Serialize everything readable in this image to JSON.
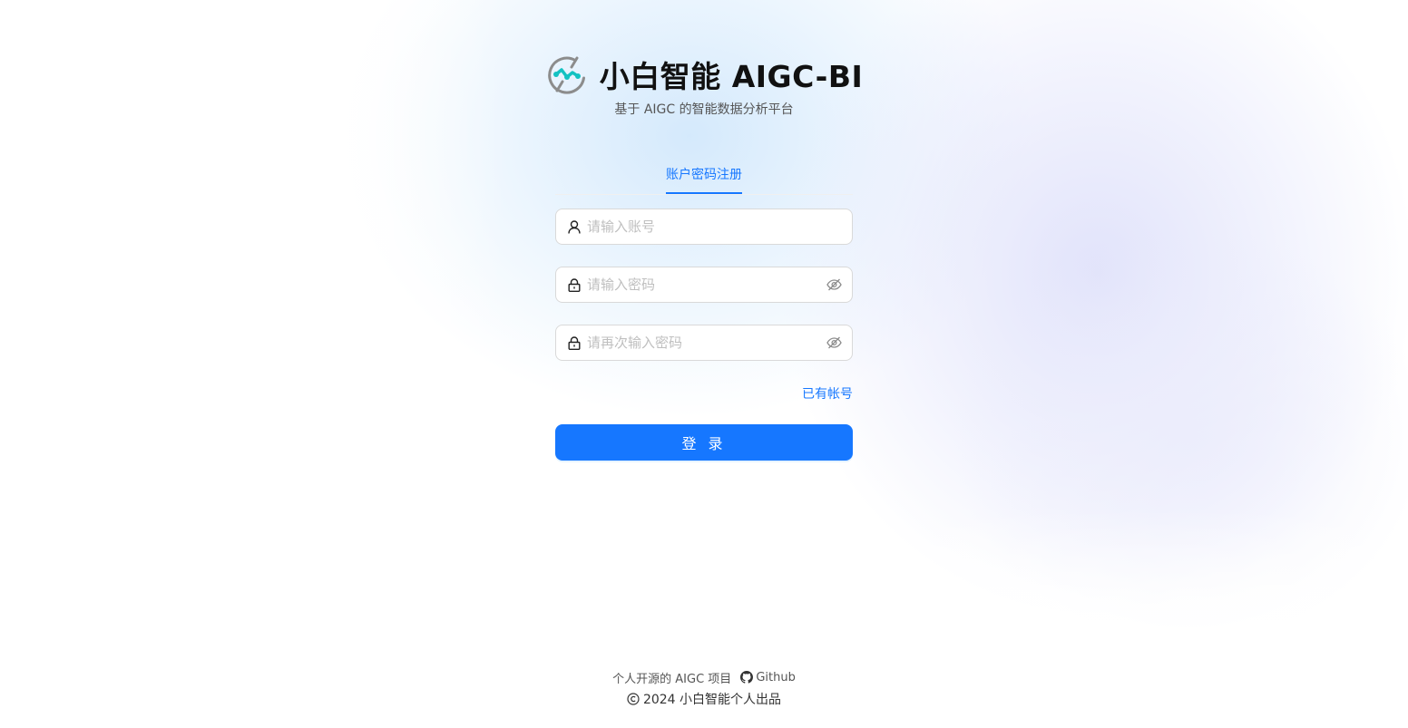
{
  "header": {
    "title": "小白智能 AIGC-BI",
    "subtitle": "基于 AIGC 的智能数据分析平台"
  },
  "tabs": [
    {
      "label": "账户密码注册",
      "active": true
    }
  ],
  "form": {
    "account": {
      "placeholder": "请输入账号",
      "value": ""
    },
    "password": {
      "placeholder": "请输入密码",
      "value": ""
    },
    "confirm_password": {
      "placeholder": "请再次输入密码",
      "value": ""
    },
    "has_account_link": "已有帐号",
    "submit_label": "登 录"
  },
  "footer": {
    "project_text": "个人开源的 AIGC 项目",
    "github_label": "Github",
    "copyright": "2024 小白智能个人出品"
  },
  "colors": {
    "primary": "#1677ff",
    "logo_accent": "#13c2c2",
    "logo_ring": "#8c8c8c"
  },
  "icons": {
    "logo": "app-logo-icon",
    "account_prefix": "user-icon",
    "password_prefix": "lock-icon",
    "password_toggle": "eye-invisible-icon",
    "github": "github-icon",
    "copyright": "copyright-icon"
  }
}
